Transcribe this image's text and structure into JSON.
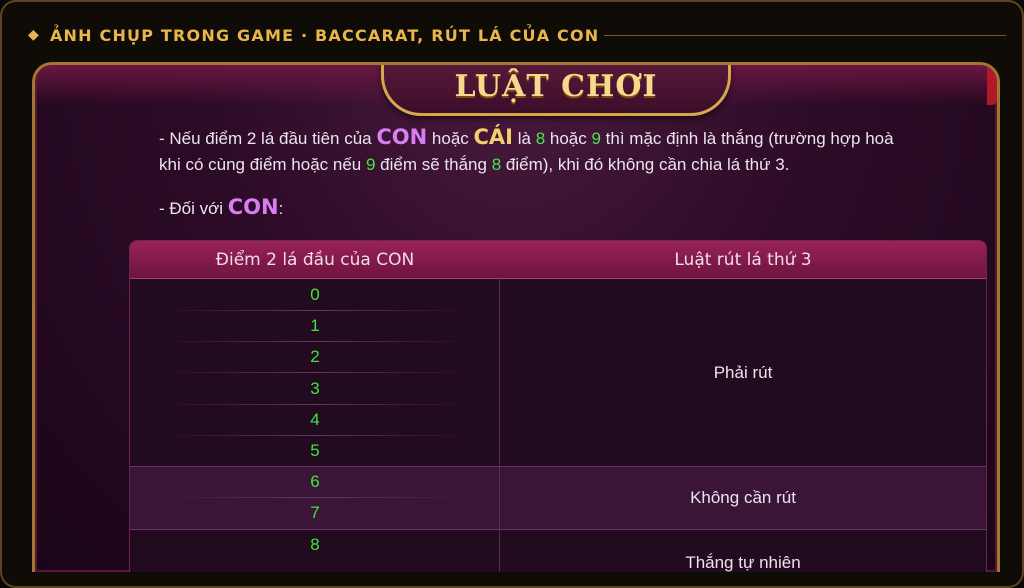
{
  "caption": {
    "text": "ẢNH CHỤP TRONG GAME · BACCARAT, RÚT LÁ CỦA CON"
  },
  "panel": {
    "title": "LUẬT CHƠI"
  },
  "rule_text": {
    "p1_a": "- Nếu điểm 2 lá đầu tiên của ",
    "kw_con": "CON",
    "p1_b": " hoặc ",
    "kw_cai": "CÁI",
    "p1_c": " là ",
    "n8": "8",
    "p1_d": " hoặc ",
    "n9": "9",
    "p1_e": " thì mặc định là thắng (trường hợp hoà",
    "p2_a": "khi có cùng điểm hoặc nếu ",
    "n9b": "9",
    "p2_b": " điểm sẽ thắng ",
    "n8b": "8",
    "p2_c": " điểm), khi đó không cần chia lá thứ 3.",
    "p3_a": "- Đối với ",
    "kw_con2": "CON",
    "p3_b": ":"
  },
  "table": {
    "headers": [
      "Điểm 2 lá đầu của CON",
      "Luật rút lá thứ 3"
    ],
    "scores": [
      "0",
      "1",
      "2",
      "3",
      "4",
      "5",
      "6",
      "7",
      "8"
    ],
    "rules": [
      "Phải rút",
      "Không cần rút",
      "Thắng tự nhiên"
    ]
  },
  "colors": {
    "accent_gold": "#e9b54c",
    "score_green": "#3ee63e",
    "con_purple": "#d77ef2",
    "cai_gold": "#f3d06b"
  }
}
